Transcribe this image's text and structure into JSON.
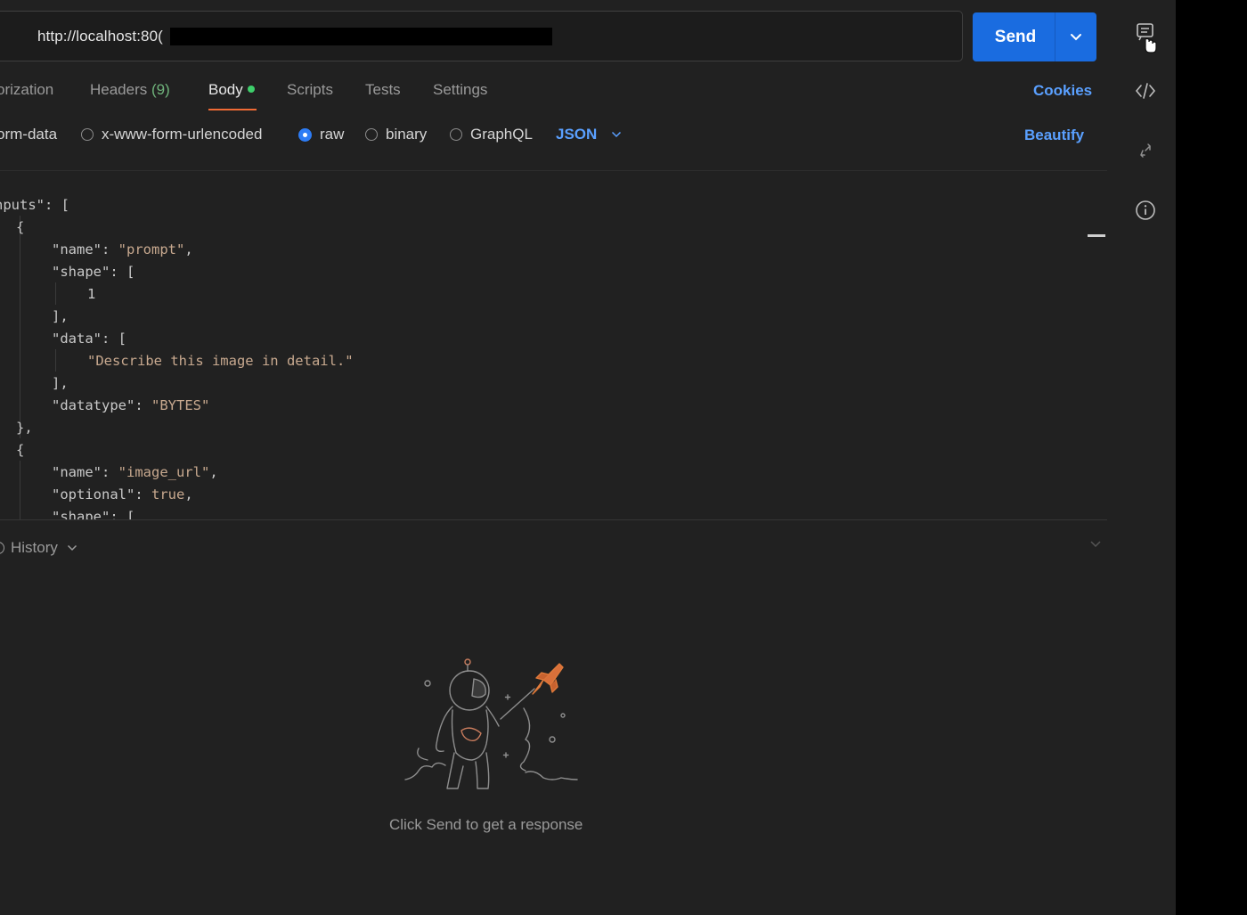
{
  "request": {
    "url_visible": "http://localhost:80(",
    "send_label": "Send"
  },
  "tabs": [
    {
      "label": "orization"
    },
    {
      "label": "Headers",
      "count": "(9)"
    },
    {
      "label": "Body"
    },
    {
      "label": "Scripts"
    },
    {
      "label": "Tests"
    },
    {
      "label": "Settings"
    }
  ],
  "cookies_label": "Cookies",
  "body_types": {
    "form_data": "orm-data",
    "urlencoded": "x-www-form-urlencoded",
    "raw": "raw",
    "binary": "binary",
    "graphql": "GraphQL",
    "raw_format": "JSON",
    "selected": "raw"
  },
  "beautify_label": "Beautify",
  "editor": {
    "lines": [
      {
        "key": "nputs",
        "rest": ": ["
      },
      {
        "text": "{"
      },
      {
        "key": "name",
        "val": "prompt"
      },
      {
        "key": "shape",
        "rest": ": ["
      },
      {
        "num": "1"
      },
      {
        "text": "],"
      },
      {
        "key": "data",
        "rest": ": ["
      },
      {
        "str": "Describe this image in detail."
      },
      {
        "text": "],"
      },
      {
        "key": "datatype",
        "val": "BYTES",
        "last": true
      },
      {
        "text": "},"
      },
      {
        "text": "{"
      },
      {
        "key": "name",
        "val": "image_url"
      },
      {
        "key": "optional",
        "bool": "true"
      },
      {
        "key": "shape",
        "rest": ": ["
      }
    ]
  },
  "response": {
    "history_label": "History",
    "empty_message": "Click Send to get a response"
  },
  "colors": {
    "accent_blue": "#1a6ce0",
    "link_blue": "#5aa0ff",
    "tab_underline": "#f06a35",
    "status_dot": "#3ecf6b",
    "rocket": "#e07a3a"
  }
}
